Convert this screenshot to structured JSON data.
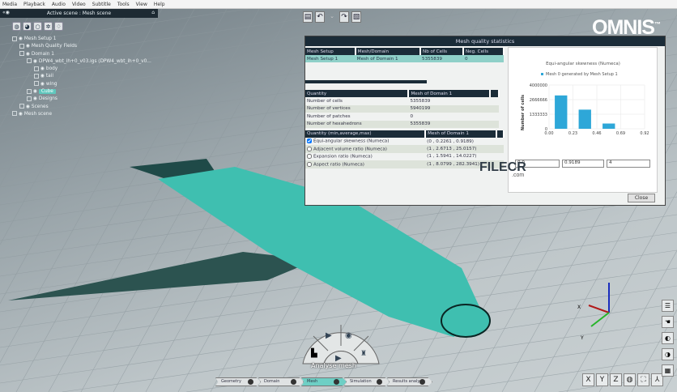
{
  "menubar": [
    "Media",
    "Playback",
    "Audio",
    "Video",
    "Subtitle",
    "Tools",
    "View",
    "Help"
  ],
  "scene_panel": {
    "title": "Active scene : Mesh scene"
  },
  "tree": [
    {
      "label": "Mesh Setup 1",
      "indent": 1
    },
    {
      "label": "Mesh Quality Fields",
      "indent": 2
    },
    {
      "label": "Domain 1",
      "indent": 2
    },
    {
      "label": "DPW4_wbt_ih+0_v03.igs (DPW4_wbt_ih+0_v0...",
      "indent": 3
    },
    {
      "label": "body",
      "indent": 4
    },
    {
      "label": "tail",
      "indent": 4
    },
    {
      "label": "wing",
      "indent": 4
    },
    {
      "label": "Cube",
      "indent": 3,
      "selected": true
    },
    {
      "label": "Designs",
      "indent": 3
    },
    {
      "label": "Scenes",
      "indent": 2
    },
    {
      "label": "Mesh scene",
      "indent": 1
    }
  ],
  "logo": "OMNIS",
  "logo_tm": "™",
  "dialog": {
    "title": "Mesh quality statistics",
    "setup_table": {
      "headers": [
        "Mesh Setup",
        "Mesh/Domain",
        "Nb of Cells",
        "Neg. Cells"
      ],
      "rows": [
        [
          "Mesh Setup 1",
          "Mesh of Domain 1",
          "5355839",
          "0"
        ]
      ]
    },
    "quantity_table": {
      "headers": [
        "Quantity",
        "Mesh of Domain 1",
        ""
      ],
      "rows": [
        [
          "Number of cells",
          "5355839"
        ],
        [
          "Number of vertices",
          "5940199"
        ],
        [
          "Number of patches",
          "0"
        ],
        [
          "Number of hexahedrons",
          "5355839"
        ]
      ]
    },
    "quality_table": {
      "headers": [
        "Quantity (min,average,max)",
        "Mesh of Domain 1",
        ""
      ],
      "rows": [
        {
          "label": "Equi-angular skewness (Numeca)",
          "value": "(0 , 0.2261 , 0.9189)",
          "checked": true
        },
        {
          "label": "Adjacent volume ratio (Numeca)",
          "value": "(1 , 2.6713 , 25.0157)",
          "checked": false
        },
        {
          "label": "Expansion ratio (Numeca)",
          "value": "(1 , 1.5941 , 14.0227)",
          "checked": false
        },
        {
          "label": "Aspect ratio (Numeca)",
          "value": "(1 , 8.0799 , 282.3941)",
          "checked": false
        }
      ]
    },
    "fields": [
      "0.0",
      "0.9189",
      "4"
    ],
    "close_label": "Close"
  },
  "chart_data": {
    "type": "bar",
    "title": "Equi-angular skewness (Numeca)",
    "legend": "Mesh 0 generated by Mesh Setup 1",
    "legend_position": "top",
    "ylabel": "Number of cells",
    "xlabel": "",
    "xticks": [
      "0.00",
      "0.23",
      "0.46",
      "0.69",
      "0.92"
    ],
    "yticks": [
      "0",
      "1333333",
      "2666666",
      "4000000"
    ],
    "xlim": [
      0,
      0.92
    ],
    "ylim": [
      0,
      4000000
    ],
    "bins": [
      [
        0,
        0.23
      ],
      [
        0.23,
        0.46
      ],
      [
        0.46,
        0.69
      ],
      [
        0.69,
        0.92
      ]
    ],
    "values": [
      3050000,
      1750000,
      480000,
      0
    ],
    "color": "#2ea7d8",
    "grid": true
  },
  "watermark": {
    "text": "FILECR",
    "sub": ".com"
  },
  "radial_menu": {
    "label": "Analyse mesh"
  },
  "workflow": [
    "Geometry",
    "Domain",
    "Mesh",
    "Simulation",
    "Results analysis"
  ],
  "workflow_active": "Mesh",
  "view_buttons": [
    "X",
    "Y",
    "Z"
  ],
  "axis_labels": [
    "X",
    "Y"
  ],
  "colors": {
    "accent": "#6ecfc5",
    "mesh": "#3fbfb0",
    "header": "#1b2c38"
  }
}
